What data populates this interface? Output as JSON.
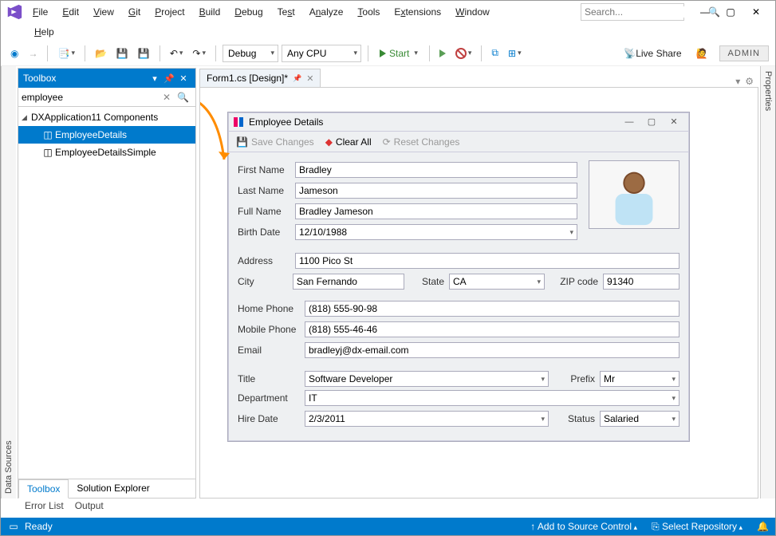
{
  "menu": {
    "row1": [
      "File",
      "Edit",
      "View",
      "Git",
      "Project",
      "Build",
      "Debug",
      "Test",
      "Analyze",
      "Tools",
      "Extensions",
      "Window"
    ],
    "row2": [
      "Help"
    ],
    "search_placeholder": "Search..."
  },
  "toolbar": {
    "config": "Debug",
    "platform": "Any CPU",
    "start": "Start",
    "live_share": "Live Share",
    "admin": "ADMIN"
  },
  "side_tabs": {
    "left": "Data Sources",
    "right": "Properties"
  },
  "toolbox": {
    "title": "Toolbox",
    "search_value": "employee",
    "group": "DXApplication11 Components",
    "items": [
      "EmployeeDetails",
      "EmployeeDetailsSimple"
    ],
    "tabs": [
      "Toolbox",
      "Solution Explorer"
    ]
  },
  "doc_tab": "Form1.cs [Design]*",
  "form": {
    "title": "Employee Details",
    "save": "Save Changes",
    "clear": "Clear All",
    "reset": "Reset Changes",
    "first_name_l": "First Name",
    "first_name": "Bradley",
    "last_name_l": "Last Name",
    "last_name": "Jameson",
    "full_name_l": "Full Name",
    "full_name": "Bradley Jameson",
    "birth_l": "Birth Date",
    "birth": "12/10/1988",
    "address_l": "Address",
    "address": "1100 Pico St",
    "city_l": "City",
    "city": "San Fernando",
    "state_l": "State",
    "state": "CA",
    "zip_l": "ZIP code",
    "zip": "91340",
    "home_l": "Home Phone",
    "home": "(818) 555-90-98",
    "mobile_l": "Mobile Phone",
    "mobile": "(818) 555-46-46",
    "email_l": "Email",
    "email": "bradleyj@dx-email.com",
    "title_l": "Title",
    "title_v": "Software Developer",
    "prefix_l": "Prefix",
    "prefix": "Mr",
    "dept_l": "Department",
    "dept": "IT",
    "hire_l": "Hire Date",
    "hire": "2/3/2011",
    "status_l": "Status",
    "status": "Salaried"
  },
  "bottom_tabs": [
    "Error List",
    "Output"
  ],
  "status": {
    "ready": "Ready",
    "source": "Add to Source Control",
    "repo": "Select Repository"
  }
}
